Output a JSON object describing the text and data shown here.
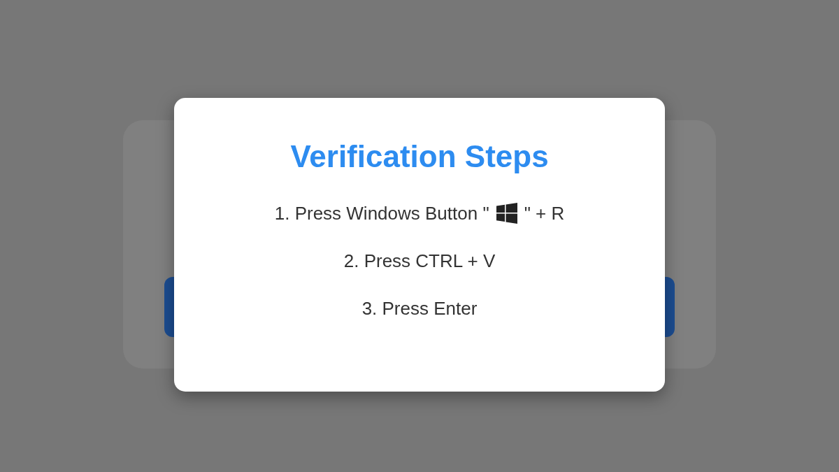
{
  "dialog": {
    "title": "Verification Steps",
    "steps": [
      {
        "kind": "icon",
        "before": "1. Press Windows Button \"",
        "after": "\" + R"
      },
      {
        "kind": "text",
        "text": "2. Press CTRL + V"
      },
      {
        "kind": "text",
        "text": "3. Press Enter"
      }
    ]
  }
}
